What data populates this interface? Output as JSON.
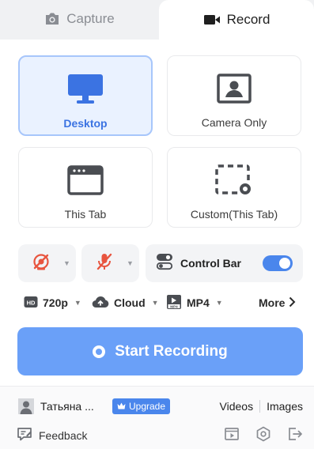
{
  "tabs": {
    "capture": "Capture",
    "record": "Record"
  },
  "modes": {
    "desktop": "Desktop",
    "camera": "Camera Only",
    "tab": "This Tab",
    "custom": "Custom(This Tab)"
  },
  "controls": {
    "control_bar_label": "Control Bar",
    "control_bar_on": true
  },
  "options": {
    "resolution": "720p",
    "save": "Cloud",
    "format": "MP4",
    "more": "More"
  },
  "start_label": "Start Recording",
  "footer": {
    "username": "Татьяна ...",
    "upgrade": "Upgrade",
    "videos": "Videos",
    "images": "Images",
    "feedback": "Feedback"
  },
  "colors": {
    "accent": "#4a86ec",
    "start_button": "#6aa0f8",
    "danger": "#e8553f",
    "selected_bg": "#eaf2ff"
  },
  "icons": [
    "camera-icon",
    "video-camera-icon",
    "monitor-icon",
    "portrait-icon",
    "browser-tab-icon",
    "custom-area-icon",
    "camera-off-icon",
    "mic-off-icon",
    "control-bar-icon",
    "hd-icon",
    "cloud-upload-icon",
    "mp4-icon",
    "chevron-right-icon",
    "user-icon",
    "crown-icon",
    "feedback-icon",
    "video-library-icon",
    "settings-icon",
    "exit-icon"
  ]
}
